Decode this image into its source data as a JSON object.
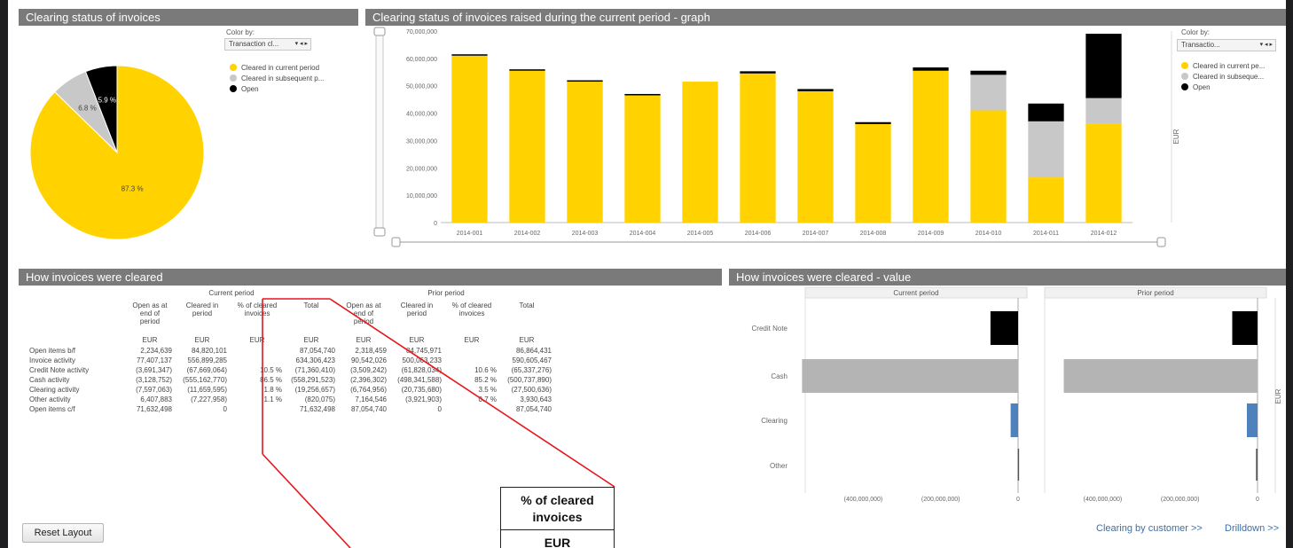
{
  "pie_panel": {
    "title": "Clearing status of invoices",
    "color_by_label": "Color by:",
    "color_by_value": "Transaction cl...",
    "legend": [
      {
        "label": "Cleared in current period",
        "color": "#ffd200"
      },
      {
        "label": "Cleared in subsequent p...",
        "color": "#c8c8c8"
      },
      {
        "label": "Open",
        "color": "#000000"
      }
    ],
    "slice_labels": [
      "87.3 %",
      "6.8 %",
      "5.9 %"
    ]
  },
  "bar_panel": {
    "title": "Clearing status of invoices raised during the current period - graph",
    "color_by_label": "Color by:",
    "color_by_value": "Transactio...",
    "legend": [
      {
        "label": "Cleared in current pe...",
        "color": "#ffd200"
      },
      {
        "label": "Cleared in subseque...",
        "color": "#c8c8c8"
      },
      {
        "label": "Open",
        "color": "#000000"
      }
    ],
    "y_unit": "EUR",
    "y_ticks": [
      "70,000,000",
      "60,000,000",
      "50,000,000",
      "40,000,000",
      "30,000,000",
      "20,000,000",
      "10,000,000",
      "0"
    ]
  },
  "chart_data": [
    {
      "type": "pie",
      "title": "Clearing status of invoices",
      "labels": [
        "Cleared in current period",
        "Cleared in subsequent p...",
        "Open"
      ],
      "values": [
        87.3,
        6.8,
        5.9
      ],
      "value_labels": [
        "87.3 %",
        "6.8 %",
        "5.9 %"
      ],
      "colors": [
        "#ffd200",
        "#c8c8c8",
        "#000000"
      ]
    },
    {
      "type": "bar",
      "stacked": true,
      "title": "Clearing status of invoices raised during the current period - graph",
      "categories": [
        "2014-001",
        "2014-002",
        "2014-003",
        "2014-004",
        "2014-005",
        "2014-006",
        "2014-007",
        "2014-008",
        "2014-009",
        "2014-010",
        "2014-011",
        "2014-012"
      ],
      "ylabel": "EUR",
      "ylim": [
        0,
        70000000
      ],
      "legend_position": "right",
      "series": [
        {
          "name": "Cleared in current pe...",
          "color": "#ffd200",
          "values": [
            61000000,
            55500000,
            51500000,
            46500000,
            51500000,
            54500000,
            48000000,
            36000000,
            55500000,
            41000000,
            16500000,
            36000000
          ]
        },
        {
          "name": "Cleared in subseque...",
          "color": "#c8c8c8",
          "values": [
            0,
            0,
            0,
            0,
            0,
            0,
            0,
            0,
            0,
            13000000,
            20500000,
            9500000
          ]
        },
        {
          "name": "Open",
          "color": "#000000",
          "values": [
            500000,
            500000,
            500000,
            500000,
            0,
            800000,
            800000,
            700000,
            1200000,
            1500000,
            6500000,
            23500000
          ]
        }
      ]
    },
    {
      "type": "bar",
      "orientation": "horizontal",
      "title": "How invoices were cleared - value",
      "panels": [
        "Current period",
        "Prior period"
      ],
      "categories": [
        "Credit Note",
        "Cash",
        "Clearing",
        "Other"
      ],
      "xlabel": "EUR",
      "xticks": [
        "(400,000,000)",
        "(200,000,000)",
        "0"
      ],
      "series": [
        {
          "name": "Current period",
          "values": [
            -71360410,
            -558291523,
            -19256657,
            -820075
          ],
          "colors": [
            "#000000",
            "#b4b4b4",
            "#4f81bd",
            "#555555"
          ]
        },
        {
          "name": "Prior period",
          "values": [
            -65337276,
            -500737890,
            -27500636,
            -3921903
          ],
          "colors": [
            "#000000",
            "#b4b4b4",
            "#4f81bd",
            "#555555"
          ]
        }
      ]
    }
  ],
  "table_panel": {
    "title": "How invoices were cleared",
    "group_headers": [
      "Current period",
      "Prior period"
    ],
    "column_headers": [
      [
        "Open as at",
        "end of",
        "period"
      ],
      [
        "Cleared in",
        "period"
      ],
      [
        "% of cleared",
        "invoices"
      ],
      [
        "Total"
      ],
      [
        "Open as at",
        "end of",
        "period"
      ],
      [
        "Cleared in",
        "period"
      ],
      [
        "% of cleared",
        "invoices"
      ],
      [
        "Total"
      ]
    ],
    "units": [
      "EUR",
      "EUR",
      "EUR",
      "EUR",
      "EUR",
      "EUR",
      "EUR",
      "EUR"
    ],
    "rows": [
      {
        "label": "Open items b/f",
        "values": [
          "2,234,639",
          "84,820,101",
          "",
          "87,054,740",
          "2,318,459",
          "84,745,971",
          "",
          "86,864,431"
        ]
      },
      {
        "label": "Invoice activity",
        "values": [
          "77,407,137",
          "556,899,285",
          "",
          "634,306,423",
          "90,542,026",
          "500,063,233",
          "",
          "590,605,467"
        ]
      },
      {
        "label": "Credit Note activity",
        "values": [
          "(3,691,347)",
          "(67,669,064)",
          "10.5 %",
          "(71,360,410)",
          "(3,509,242)",
          "(61,828,034)",
          "10.6 %",
          "(65,337,276)"
        ]
      },
      {
        "label": "Cash activity",
        "values": [
          "(3,128,752)",
          "(555,162,770)",
          "86.5 %",
          "(558,291,523)",
          "(2,396,302)",
          "(498,341,588)",
          "85.2 %",
          "(500,737,890)"
        ]
      },
      {
        "label": "Clearing activity",
        "values": [
          "(7,597,063)",
          "(11,659,595)",
          "1.8 %",
          "(19,256,657)",
          "(6,764,956)",
          "(20,735,680)",
          "3.5 %",
          "(27,500,636)"
        ]
      },
      {
        "label": "Other activity",
        "values": [
          "6,407,883",
          "(7,227,958)",
          "1.1 %",
          "(820,075)",
          "7,164,546",
          "(3,921,903)",
          "0.7 %",
          "3,930,643"
        ]
      },
      {
        "label": "Open items c/f",
        "values": [
          "71,632,498",
          "0",
          "",
          "71,632,498",
          "87,054,740",
          "0",
          "",
          "87,054,740"
        ]
      }
    ]
  },
  "hbar_panel": {
    "title": "How invoices were cleared - value",
    "unit": "EUR"
  },
  "footer": {
    "reset_label": "Reset Layout",
    "link_customer": "Clearing by customer >>",
    "link_drilldown": "Drilldown >>"
  },
  "callout": {
    "title": "% of cleared invoices",
    "unit": "EUR"
  }
}
